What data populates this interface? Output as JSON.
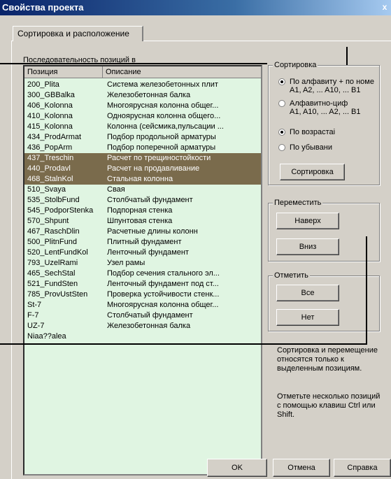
{
  "window": {
    "title": "Свойства проекта",
    "close_glyph": "x"
  },
  "tabs": [
    {
      "label": "Сортировка и расположение"
    }
  ],
  "list": {
    "caption": "Последовательность позиций в",
    "columns": [
      "Позиция",
      "Описание"
    ],
    "rows": [
      {
        "pos": "200_Plita",
        "desc": "Система железобетонных плит",
        "selected": false
      },
      {
        "pos": "300_GBBalka",
        "desc": "Железобетонная балка",
        "selected": false
      },
      {
        "pos": "406_Kolonna",
        "desc": "Многоярусная колонна общег...",
        "selected": false
      },
      {
        "pos": "410_Kolonna",
        "desc": "Одноярусная колонна общего...",
        "selected": false
      },
      {
        "pos": "415_Kolonna",
        "desc": "Колонна (сейсмика,пульсации ...",
        "selected": false
      },
      {
        "pos": "434_ProdArmat",
        "desc": "Подбор продольной арматуры",
        "selected": false
      },
      {
        "pos": "436_PopArm",
        "desc": "Подбор поперечной арматуры",
        "selected": false
      },
      {
        "pos": "437_Treschin",
        "desc": "Расчет по трещиностойкости",
        "selected": true
      },
      {
        "pos": "440_Prodavl",
        "desc": "Расчет на продавливание",
        "selected": true
      },
      {
        "pos": "468_StalnKol",
        "desc": "Стальная колонна",
        "selected": true
      },
      {
        "pos": "510_Svaya",
        "desc": "Свая",
        "selected": false
      },
      {
        "pos": "535_StolbFund",
        "desc": "Столбчатый фундамент",
        "selected": false
      },
      {
        "pos": "545_PodporStenka",
        "desc": "Подпорная стенка",
        "selected": false
      },
      {
        "pos": "570_Shpunt",
        "desc": "Шпунтовая стенка",
        "selected": false
      },
      {
        "pos": "467_RaschDlin",
        "desc": "Расчетные длины колонн",
        "selected": false
      },
      {
        "pos": "500_PlitnFund",
        "desc": "Плитный фундамент",
        "selected": false
      },
      {
        "pos": "520_LentFundKol",
        "desc": "Ленточный фундамент",
        "selected": false
      },
      {
        "pos": "793_UzelRami",
        "desc": "Узел рамы",
        "selected": false
      },
      {
        "pos": "465_SechStal",
        "desc": "Подбор сечения стального эл...",
        "selected": false
      },
      {
        "pos": "521_FundSten",
        "desc": "Ленточный фундамент под ст...",
        "selected": false
      },
      {
        "pos": "785_ProvUstSten",
        "desc": "Проверка устойчивости стенк...",
        "selected": false
      },
      {
        "pos": "St-7",
        "desc": "Многоярусная колонна общег...",
        "selected": false
      },
      {
        "pos": "F-7",
        "desc": "Столбчатый фундамент",
        "selected": false
      },
      {
        "pos": "UZ-7",
        "desc": "Железобетонная балка",
        "selected": false
      },
      {
        "pos": "Niaa??alea",
        "desc": "",
        "selected": false
      }
    ],
    "selection_color": "#7a6b4c",
    "background_color": "#e0f5e2"
  },
  "sort_group": {
    "title": "Сортировка",
    "alpha_option": {
      "line1": "По алфавиту + по номе",
      "line2": "A1, A2, ... A10, ... B1",
      "checked": true
    },
    "alnum_option": {
      "line1": "Алфавитно-циф",
      "line2": "A1, A10, ... A2, ... B1",
      "checked": false
    },
    "asc_option": {
      "label": "По возрастаі",
      "checked": true
    },
    "desc_option": {
      "label": "По убывани",
      "checked": false
    },
    "sort_button": "Сортировка"
  },
  "move_group": {
    "title": "Переместить",
    "up_button": "Наверх",
    "down_button": "Вниз"
  },
  "mark_group": {
    "title": "Отметить",
    "all_button": "Все",
    "none_button": "Нет"
  },
  "notes": {
    "note1": "Сортировка и перемещение относятся только к выделенным позициям.",
    "note2": "Отметьте несколько позиций с помощью клавиш Ctrl или Shift."
  },
  "footer": {
    "ok": "OK",
    "cancel": "Отмена",
    "help": "Справка"
  }
}
